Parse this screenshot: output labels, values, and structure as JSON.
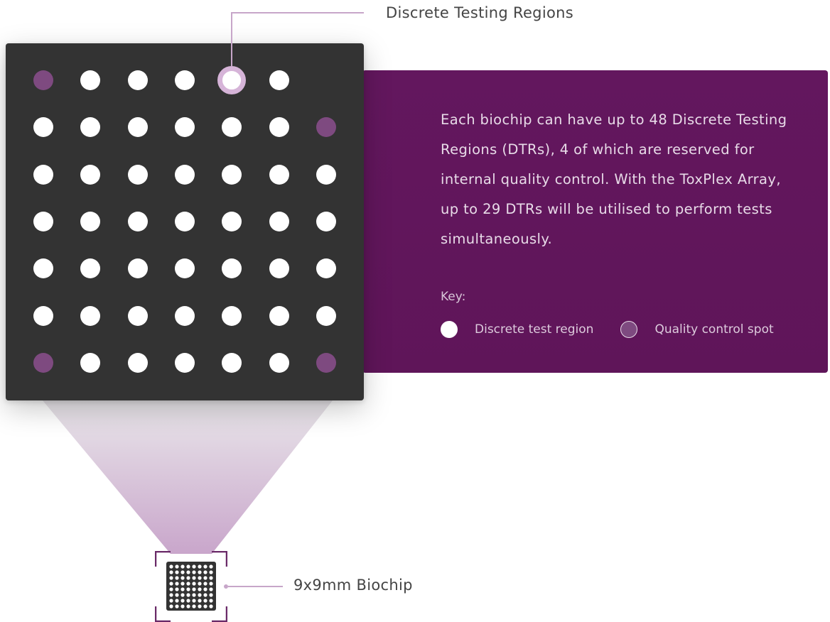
{
  "callout": {
    "label": "Discrete Testing Regions"
  },
  "info": {
    "description": "Each biochip can have up to 48 Discrete Testing Regions (DTRs), 4 of which are reserved for internal quality control. With the ToxPlex Array, up to 29 DTRs will be utilised to perform tests simultaneously.",
    "key_title": "Key:",
    "key_items": [
      {
        "label": "Discrete test region",
        "kind": "dtr"
      },
      {
        "label": "Quality control spot",
        "kind": "qc"
      }
    ]
  },
  "biochip": {
    "label": "9x9mm Biochip"
  },
  "grid": {
    "rows": [
      [
        "qc",
        "dtr",
        "dtr",
        "dtr",
        "highlight",
        "dtr",
        "empty"
      ],
      [
        "dtr",
        "dtr",
        "dtr",
        "dtr",
        "dtr",
        "dtr",
        "qc"
      ],
      [
        "dtr",
        "dtr",
        "dtr",
        "dtr",
        "dtr",
        "dtr",
        "dtr"
      ],
      [
        "dtr",
        "dtr",
        "dtr",
        "dtr",
        "dtr",
        "dtr",
        "dtr"
      ],
      [
        "dtr",
        "dtr",
        "dtr",
        "dtr",
        "dtr",
        "dtr",
        "dtr"
      ],
      [
        "dtr",
        "dtr",
        "dtr",
        "dtr",
        "dtr",
        "dtr",
        "dtr"
      ],
      [
        "qc",
        "dtr",
        "dtr",
        "dtr",
        "dtr",
        "dtr",
        "qc"
      ]
    ]
  },
  "colors": {
    "panel_dark": "#333333",
    "info_purple": "#63175e",
    "qc_dot": "#7e4a80",
    "accent_light": "#d6b4d8",
    "dtr_dot": "#ffffff"
  }
}
